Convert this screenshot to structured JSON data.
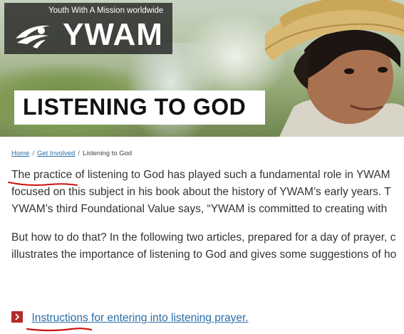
{
  "logo": {
    "tagline": "Youth With A Mission worldwide",
    "wordmark": "YWAM"
  },
  "hero": {
    "title": "LISTENING TO GOD"
  },
  "breadcrumb": {
    "home": "Home",
    "sep1": "/",
    "get_involved": "Get Involved",
    "sep2": "/",
    "current": "Listening to God"
  },
  "content": {
    "paragraph1": [
      "The practice of listening to God has played such a fundamental role in YWAM",
      "focused on this subject in his book about the history of YWAM’s early years. T",
      "YWAM’s third Foundational Value says, “YWAM is committed to creating with"
    ],
    "paragraph2": [
      "But how to do that? In the following two articles, prepared for a day of prayer, c",
      "illustrates the importance of listening to God and gives some suggestions of ho"
    ]
  },
  "links": {
    "instructions": "Instructions for entering into listening prayer."
  },
  "colors": {
    "link": "#2a6ea8",
    "arrow": "#b52a2a",
    "annotation": "#cc1111"
  }
}
